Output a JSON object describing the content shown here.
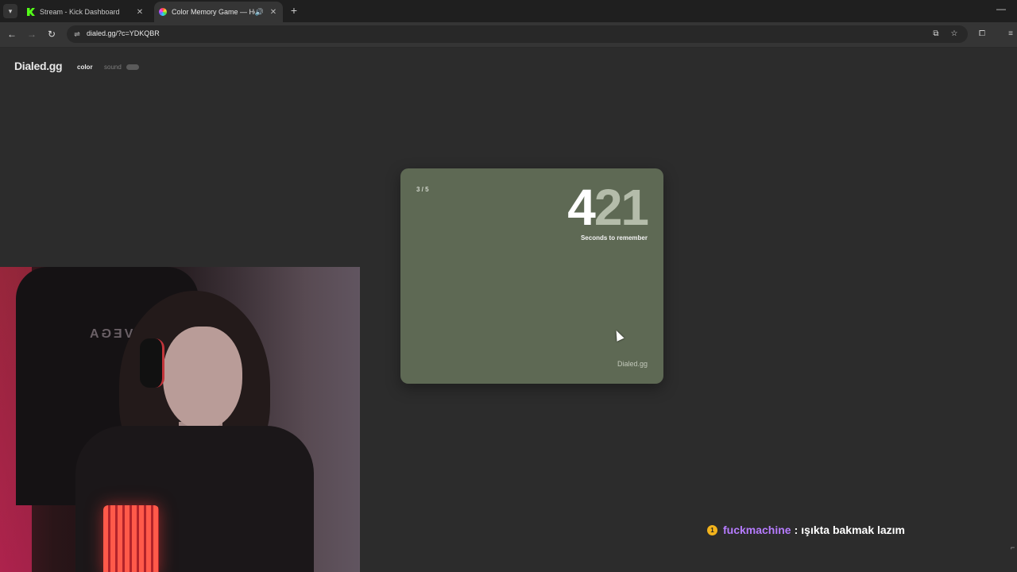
{
  "browser": {
    "tabs": [
      {
        "title": "Stream - Kick Dashboard",
        "active": false,
        "favicon": "kick-icon"
      },
      {
        "title": "Color Memory Game — Ho",
        "active": true,
        "favicon": "color-wheel-icon"
      }
    ],
    "url": "dialed.gg/?c=YDKQBR",
    "icons": {
      "tab_list": "▾",
      "close": "✕",
      "audio": "🔊",
      "new_tab": "+",
      "minimize": "—",
      "back": "←",
      "forward": "→",
      "reload": "↻",
      "site_info": "⇌",
      "install": "⧉",
      "bookmark": "☆",
      "extensions": "⧠",
      "menu": "≡"
    }
  },
  "page": {
    "logo": "Dialed.gg",
    "modes": {
      "color": "color",
      "sound": "sound"
    }
  },
  "game": {
    "round": "3 / 5",
    "timer_int": "4",
    "timer_dec": "21",
    "timer_label": "Seconds to remember",
    "card_brand": "Dialed.gg",
    "card_color": "#5e6954"
  },
  "chat": {
    "badge": "1",
    "username": "fuckmachine",
    "separator": ":",
    "message": "ışıkta bakmak lazım"
  },
  "colors": {
    "accent_user": "#b67cff",
    "kick_green": "#53fc18"
  }
}
